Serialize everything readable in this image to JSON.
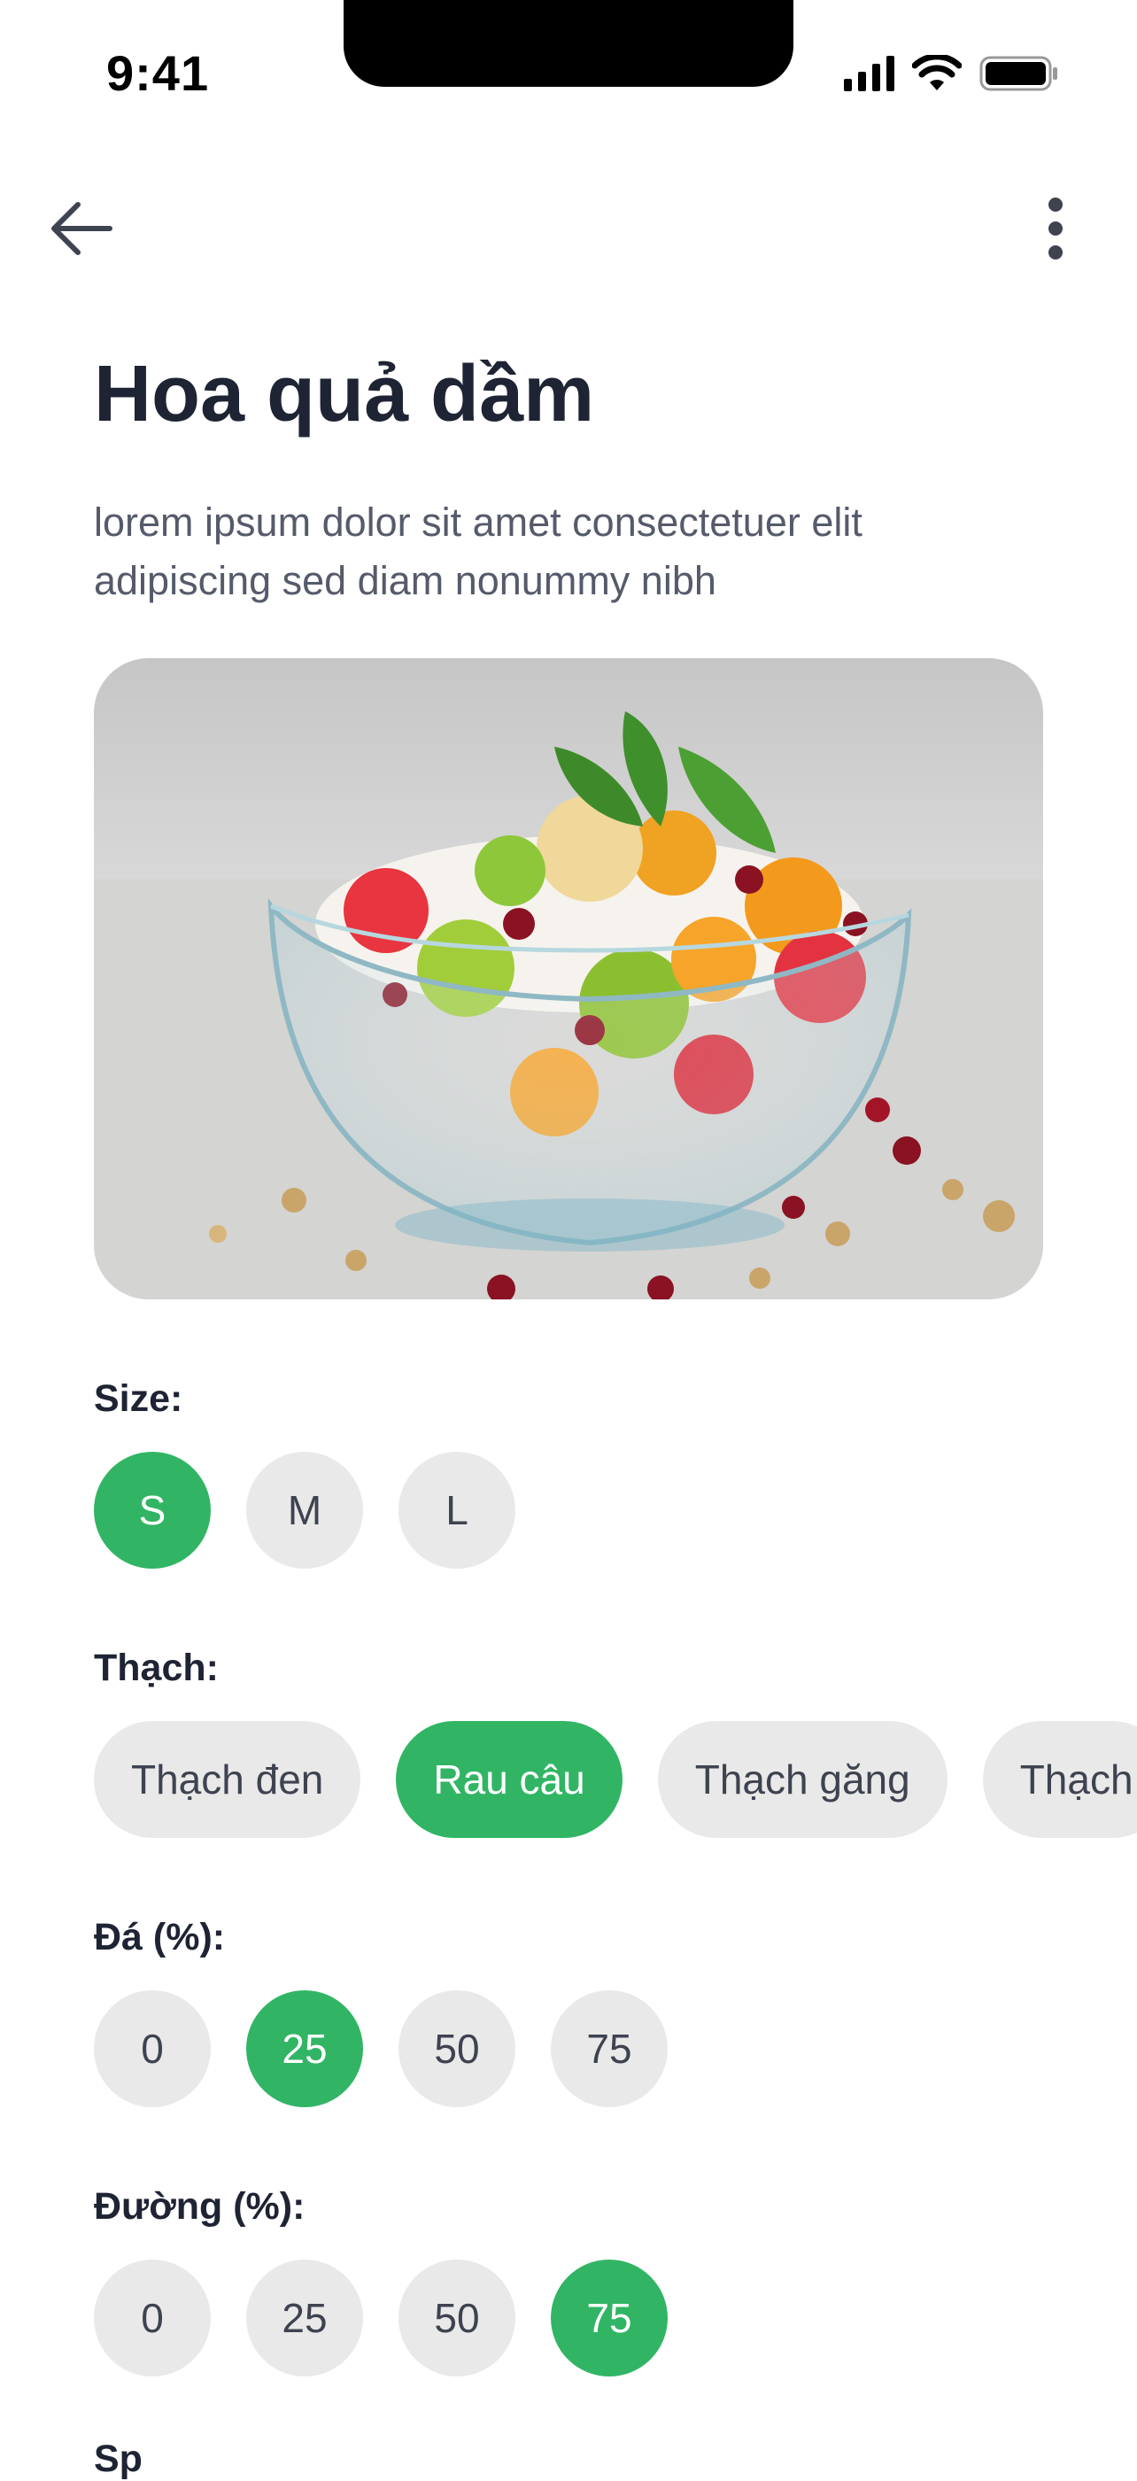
{
  "status_bar": {
    "time": "9:41"
  },
  "nav": {
    "back_icon": "arrow-left-icon",
    "more_icon": "more-vertical-icon"
  },
  "product": {
    "title": "Hoa quả dầm",
    "description": "lorem ipsum dolor sit amet consectetuer elit adipiscing sed diam nonummy nibh"
  },
  "options": {
    "size": {
      "label": "Size:",
      "choices": [
        "S",
        "M",
        "L"
      ],
      "selected": "S"
    },
    "jelly": {
      "label": "Thạch:",
      "choices": [
        "Thạch đen",
        "Rau câu",
        "Thạch găng",
        "Thạch"
      ],
      "selected": "Rau câu"
    },
    "ice": {
      "label": "Đá (%):",
      "choices": [
        "0",
        "25",
        "50",
        "75"
      ],
      "selected": "25"
    },
    "sugar": {
      "label": "Đường (%):",
      "choices": [
        "0",
        "25",
        "50",
        "75"
      ],
      "selected": "75"
    },
    "next_section_label": "Sp"
  },
  "colors": {
    "accent": "#31b564",
    "chip_background": "#e9e9e9",
    "title_text": "#1e2433",
    "body_text": "#555b6a"
  }
}
